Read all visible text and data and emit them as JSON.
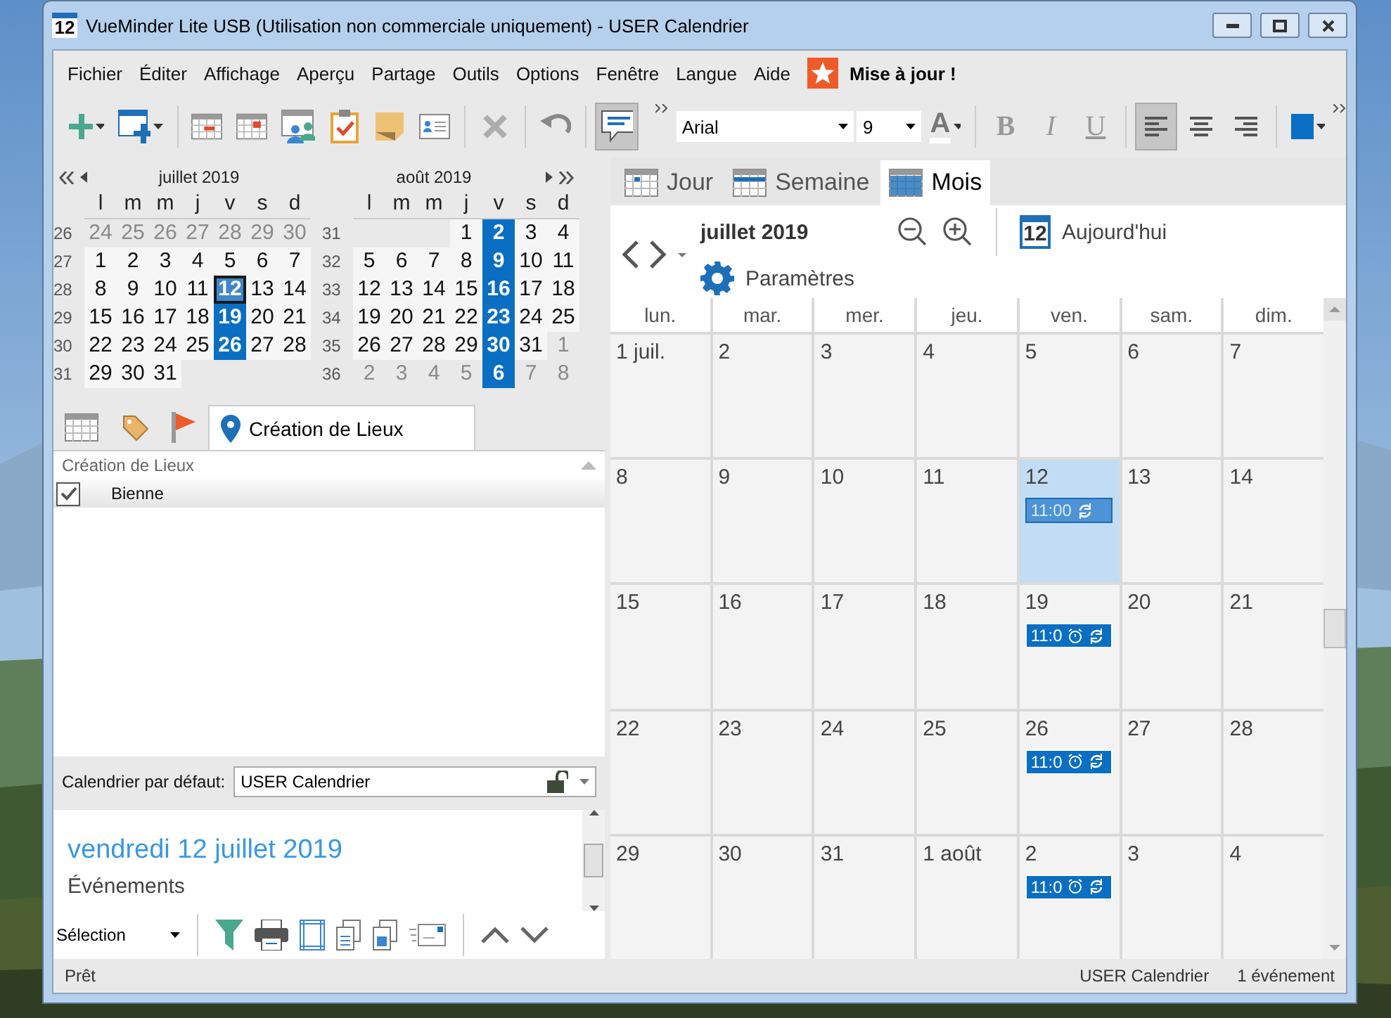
{
  "window": {
    "title": "VueMinder Lite USB (Utilisation non commerciale uniquement) - USER Calendrier",
    "app_icon_label": "12"
  },
  "menu": [
    "Fichier",
    "Éditer",
    "Affichage",
    "Aperçu",
    "Partage",
    "Outils",
    "Options",
    "Fenêtre",
    "Langue",
    "Aide"
  ],
  "update": {
    "label": "Mise à jour !"
  },
  "toolbar": {
    "tools": [
      {
        "kind": "add",
        "disabled": false
      },
      {
        "kind": "calendar_add",
        "disabled": false
      },
      {
        "kind": "calendar_remove",
        "disabled": false
      },
      {
        "kind": "calendar_flag",
        "disabled": false
      },
      {
        "kind": "calendar_people",
        "disabled": false
      },
      {
        "kind": "clipboard_check",
        "disabled": false
      },
      {
        "kind": "sticky_note",
        "disabled": false
      },
      {
        "kind": "contact_card",
        "disabled": false
      },
      {
        "kind": "delete",
        "disabled": true
      },
      {
        "kind": "undo",
        "disabled": false
      }
    ],
    "comment": {
      "pressed": true
    },
    "font": "Arial",
    "size": "9",
    "color_label": "A",
    "styles": [
      {
        "label": "B",
        "kind": "bold",
        "disabled": true
      },
      {
        "label": "I",
        "kind": "italic",
        "disabled": true
      },
      {
        "label": "U",
        "kind": "underline",
        "disabled": true
      }
    ],
    "aligns": [
      {
        "kind": "left",
        "selected": true
      },
      {
        "kind": "center",
        "selected": false
      },
      {
        "kind": "right",
        "selected": false
      }
    ]
  },
  "mini_calendar": [
    {
      "title": "juillet 2019",
      "weekdays": [
        "l",
        "m",
        "m",
        "j",
        "v",
        "s",
        "d"
      ],
      "weeks": [
        {
          "number": "26",
          "days": [
            {
              "d": "24",
              "muted": true,
              "selected": false,
              "today": false
            },
            {
              "d": "25",
              "muted": true,
              "selected": false,
              "today": false
            },
            {
              "d": "26",
              "muted": true,
              "selected": false,
              "today": false
            },
            {
              "d": "27",
              "muted": true,
              "selected": false,
              "today": false
            },
            {
              "d": "28",
              "muted": true,
              "selected": false,
              "today": false
            },
            {
              "d": "29",
              "muted": true,
              "selected": false,
              "today": false
            },
            {
              "d": "30",
              "muted": true,
              "selected": false,
              "today": false
            }
          ]
        },
        {
          "number": "27",
          "days": [
            {
              "d": "1",
              "muted": false,
              "selected": false,
              "today": false
            },
            {
              "d": "2",
              "muted": false,
              "selected": false,
              "today": false
            },
            {
              "d": "3",
              "muted": false,
              "selected": false,
              "today": false
            },
            {
              "d": "4",
              "muted": false,
              "selected": false,
              "today": false
            },
            {
              "d": "5",
              "muted": false,
              "selected": false,
              "today": false
            },
            {
              "d": "6",
              "muted": false,
              "selected": false,
              "today": false
            },
            {
              "d": "7",
              "muted": false,
              "selected": false,
              "today": false
            }
          ]
        },
        {
          "number": "28",
          "days": [
            {
              "d": "8",
              "muted": false,
              "selected": false,
              "today": false
            },
            {
              "d": "9",
              "muted": false,
              "selected": false,
              "today": false
            },
            {
              "d": "10",
              "muted": false,
              "selected": false,
              "today": false
            },
            {
              "d": "11",
              "muted": false,
              "selected": false,
              "today": false
            },
            {
              "d": "12",
              "muted": false,
              "selected": true,
              "today": true
            },
            {
              "d": "13",
              "muted": false,
              "selected": false,
              "today": false
            },
            {
              "d": "14",
              "muted": false,
              "selected": false,
              "today": false
            }
          ]
        },
        {
          "number": "29",
          "days": [
            {
              "d": "15",
              "muted": false,
              "selected": false,
              "today": false
            },
            {
              "d": "16",
              "muted": false,
              "selected": false,
              "today": false
            },
            {
              "d": "17",
              "muted": false,
              "selected": false,
              "today": false
            },
            {
              "d": "18",
              "muted": false,
              "selected": false,
              "today": false
            },
            {
              "d": "19",
              "muted": false,
              "selected": true,
              "today": false
            },
            {
              "d": "20",
              "muted": false,
              "selected": false,
              "today": false
            },
            {
              "d": "21",
              "muted": false,
              "selected": false,
              "today": false
            }
          ]
        },
        {
          "number": "30",
          "days": [
            {
              "d": "22",
              "muted": false,
              "selected": false,
              "today": false
            },
            {
              "d": "23",
              "muted": false,
              "selected": false,
              "today": false
            },
            {
              "d": "24",
              "muted": false,
              "selected": false,
              "today": false
            },
            {
              "d": "25",
              "muted": false,
              "selected": false,
              "today": false
            },
            {
              "d": "26",
              "muted": false,
              "selected": true,
              "today": false
            },
            {
              "d": "27",
              "muted": false,
              "selected": false,
              "today": false
            },
            {
              "d": "28",
              "muted": false,
              "selected": false,
              "today": false
            }
          ]
        },
        {
          "number": "31",
          "days": [
            {
              "d": "29",
              "muted": false,
              "selected": false,
              "today": false
            },
            {
              "d": "30",
              "muted": false,
              "selected": false,
              "today": false
            },
            {
              "d": "31",
              "muted": false,
              "selected": false,
              "today": false
            }
          ]
        }
      ]
    },
    {
      "title": "août 2019",
      "weekdays": [
        "l",
        "m",
        "m",
        "j",
        "v",
        "s",
        "d"
      ],
      "weeks": [
        {
          "number": "31",
          "days": [
            {
              "d": "1",
              "muted": false,
              "selected": false,
              "today": false
            },
            {
              "d": "2",
              "muted": false,
              "selected": true,
              "today": false
            },
            {
              "d": "3",
              "muted": false,
              "selected": false,
              "today": false
            },
            {
              "d": "4",
              "muted": false,
              "selected": false,
              "today": false
            }
          ]
        },
        {
          "number": "32",
          "days": [
            {
              "d": "5",
              "muted": false,
              "selected": false,
              "today": false
            },
            {
              "d": "6",
              "muted": false,
              "selected": false,
              "today": false
            },
            {
              "d": "7",
              "muted": false,
              "selected": false,
              "today": false
            },
            {
              "d": "8",
              "muted": false,
              "selected": false,
              "today": false
            },
            {
              "d": "9",
              "muted": false,
              "selected": true,
              "today": false
            },
            {
              "d": "10",
              "muted": false,
              "selected": false,
              "today": false
            },
            {
              "d": "11",
              "muted": false,
              "selected": false,
              "today": false
            }
          ]
        },
        {
          "number": "33",
          "days": [
            {
              "d": "12",
              "muted": false,
              "selected": false,
              "today": false
            },
            {
              "d": "13",
              "muted": false,
              "selected": false,
              "today": false
            },
            {
              "d": "14",
              "muted": false,
              "selected": false,
              "today": false
            },
            {
              "d": "15",
              "muted": false,
              "selected": false,
              "today": false
            },
            {
              "d": "16",
              "muted": false,
              "selected": true,
              "today": false
            },
            {
              "d": "17",
              "muted": false,
              "selected": false,
              "today": false
            },
            {
              "d": "18",
              "muted": false,
              "selected": false,
              "today": false
            }
          ]
        },
        {
          "number": "34",
          "days": [
            {
              "d": "19",
              "muted": false,
              "selected": false,
              "today": false
            },
            {
              "d": "20",
              "muted": false,
              "selected": false,
              "today": false
            },
            {
              "d": "21",
              "muted": false,
              "selected": false,
              "today": false
            },
            {
              "d": "22",
              "muted": false,
              "selected": false,
              "today": false
            },
            {
              "d": "23",
              "muted": false,
              "selected": true,
              "today": false
            },
            {
              "d": "24",
              "muted": false,
              "selected": false,
              "today": false
            },
            {
              "d": "25",
              "muted": false,
              "selected": false,
              "today": false
            }
          ]
        },
        {
          "number": "35",
          "days": [
            {
              "d": "26",
              "muted": false,
              "selected": false,
              "today": false
            },
            {
              "d": "27",
              "muted": false,
              "selected": false,
              "today": false
            },
            {
              "d": "28",
              "muted": false,
              "selected": false,
              "today": false
            },
            {
              "d": "29",
              "muted": false,
              "selected": false,
              "today": false
            },
            {
              "d": "30",
              "muted": false,
              "selected": true,
              "today": false
            },
            {
              "d": "31",
              "muted": false,
              "selected": false,
              "today": false
            },
            {
              "d": "1",
              "muted": true,
              "selected": false,
              "today": false
            }
          ]
        },
        {
          "number": "36",
          "days": [
            {
              "d": "2",
              "muted": true,
              "selected": false,
              "today": false
            },
            {
              "d": "3",
              "muted": true,
              "selected": false,
              "today": false
            },
            {
              "d": "4",
              "muted": true,
              "selected": false,
              "today": false
            },
            {
              "d": "5",
              "muted": true,
              "selected": false,
              "today": false
            },
            {
              "d": "6",
              "muted": true,
              "selected": true,
              "today": false
            },
            {
              "d": "7",
              "muted": true,
              "selected": false,
              "today": false
            },
            {
              "d": "8",
              "muted": true,
              "selected": false,
              "today": false
            }
          ]
        }
      ]
    }
  ],
  "left_tabs": [
    {
      "kind": "calendar",
      "selected": false
    },
    {
      "kind": "tag",
      "selected": false
    },
    {
      "kind": "flag",
      "selected": false
    },
    {
      "kind": "location",
      "label": "Création de Lieux",
      "selected": true
    }
  ],
  "locations": {
    "header": "Création de Lieux",
    "items": [
      {
        "label": "Bienne",
        "checked": true
      }
    ]
  },
  "default_calendar": {
    "label": "Calendrier par défaut:",
    "value": "USER Calendrier",
    "locked": false
  },
  "details": {
    "date": "vendredi 12 juillet 2019",
    "section": "Événements"
  },
  "bottom_bar": {
    "filter": "Sélection"
  },
  "views": [
    {
      "label": "Jour",
      "kind": "day",
      "selected": false
    },
    {
      "label": "Semaine",
      "kind": "week",
      "selected": false
    },
    {
      "label": "Mois",
      "kind": "month",
      "selected": true
    }
  ],
  "header": {
    "month": "juillet 2019",
    "today_icon_label": "12",
    "today": "Aujourd'hui",
    "settings": "Paramètres"
  },
  "month_grid": {
    "weekdays": [
      "lun.",
      "mar.",
      "mer.",
      "jeu.",
      "ven.",
      "sam.",
      "dim."
    ],
    "weeks": [
      {
        "days": [
          {
            "label": "1 juil.",
            "selected": false
          },
          {
            "label": "2",
            "selected": false
          },
          {
            "label": "3",
            "selected": false
          },
          {
            "label": "4",
            "selected": false
          },
          {
            "label": "5",
            "selected": false
          },
          {
            "label": "6",
            "selected": false
          },
          {
            "label": "7",
            "selected": false
          }
        ]
      },
      {
        "days": [
          {
            "label": "8",
            "selected": false
          },
          {
            "label": "9",
            "selected": false
          },
          {
            "label": "10",
            "selected": false
          },
          {
            "label": "11",
            "selected": false
          },
          {
            "label": "12",
            "selected": true,
            "events": [
              {
                "time": "11:00",
                "selected": true
              }
            ]
          },
          {
            "label": "13",
            "selected": false
          },
          {
            "label": "14",
            "selected": false
          }
        ]
      },
      {
        "days": [
          {
            "label": "15",
            "selected": false
          },
          {
            "label": "16",
            "selected": false
          },
          {
            "label": "17",
            "selected": false
          },
          {
            "label": "18",
            "selected": false
          },
          {
            "label": "19",
            "selected": false,
            "events": [
              {
                "time": "11:0",
                "selected": false
              }
            ]
          },
          {
            "label": "20",
            "selected": false
          },
          {
            "label": "21",
            "selected": false
          }
        ]
      },
      {
        "days": [
          {
            "label": "22",
            "selected": false
          },
          {
            "label": "23",
            "selected": false
          },
          {
            "label": "24",
            "selected": false
          },
          {
            "label": "25",
            "selected": false
          },
          {
            "label": "26",
            "selected": false,
            "events": [
              {
                "time": "11:0",
                "selected": false
              }
            ]
          },
          {
            "label": "27",
            "selected": false
          },
          {
            "label": "28",
            "selected": false
          }
        ]
      },
      {
        "days": [
          {
            "label": "29",
            "selected": false
          },
          {
            "label": "30",
            "selected": false
          },
          {
            "label": "31",
            "selected": false
          },
          {
            "label": "1 août",
            "selected": false
          },
          {
            "label": "2",
            "selected": false,
            "events": [
              {
                "time": "11:0",
                "selected": false
              }
            ]
          },
          {
            "label": "3",
            "selected": false
          },
          {
            "label": "4",
            "selected": false
          }
        ]
      }
    ]
  },
  "status": {
    "left": "Prêt",
    "calendar": "USER Calendrier",
    "count": "1 événement"
  }
}
